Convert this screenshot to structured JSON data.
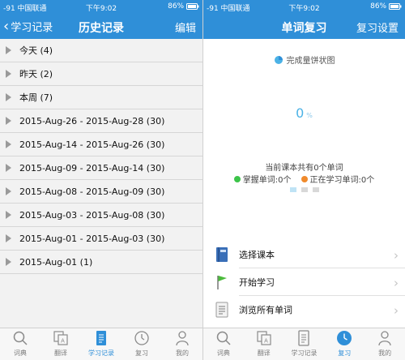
{
  "left_screen": {
    "status": {
      "carrier": "-91 中国联通",
      "time": "下午9:02",
      "battery": "86%"
    },
    "nav": {
      "back_label": "学习记录",
      "title": "历史记录",
      "edit_label": "编辑"
    },
    "history_rows": [
      {
        "label": "今天 (4)"
      },
      {
        "label": "昨天 (2)"
      },
      {
        "label": "本周 (7)"
      },
      {
        "label": "2015-Aug-26 - 2015-Aug-28 (30)"
      },
      {
        "label": "2015-Aug-14 - 2015-Aug-26 (30)"
      },
      {
        "label": "2015-Aug-09 - 2015-Aug-14 (30)"
      },
      {
        "label": "2015-Aug-08 - 2015-Aug-09 (30)"
      },
      {
        "label": "2015-Aug-03 - 2015-Aug-08 (30)"
      },
      {
        "label": "2015-Aug-01 - 2015-Aug-03 (30)"
      },
      {
        "label": "2015-Aug-01 (1)"
      }
    ],
    "tabs": [
      {
        "label": "词典",
        "icon": "search-icon",
        "active": false
      },
      {
        "label": "翻译",
        "icon": "translate-icon",
        "active": false
      },
      {
        "label": "学习记录",
        "icon": "notes-icon",
        "active": true
      },
      {
        "label": "复习",
        "icon": "clock-icon",
        "active": false
      },
      {
        "label": "我的",
        "icon": "person-icon",
        "active": false
      }
    ]
  },
  "right_screen": {
    "status": {
      "carrier": "-91 中国联通",
      "time": "下午9:02",
      "battery": "86%"
    },
    "nav": {
      "title": "单词复习",
      "settings_label": "复习设置"
    },
    "chart": {
      "title": "完成量饼状图",
      "percent_value": "0",
      "percent_unit": "%",
      "total_text": "当前课本共有0个单词",
      "mastered_text": "掌握单词:0个",
      "learning_text": "正在学习单词:0个"
    },
    "menu": [
      {
        "label": "选择课本",
        "icon": "book-icon"
      },
      {
        "label": "开始学习",
        "icon": "flag-icon"
      },
      {
        "label": "浏览所有单词",
        "icon": "list-icon"
      }
    ],
    "tabs": [
      {
        "label": "词典",
        "icon": "search-icon",
        "active": false
      },
      {
        "label": "翻译",
        "icon": "translate-icon",
        "active": false
      },
      {
        "label": "学习记录",
        "icon": "notes-icon",
        "active": false
      },
      {
        "label": "复习",
        "icon": "clock-icon",
        "active": true
      },
      {
        "label": "我的",
        "icon": "person-icon",
        "active": false
      }
    ]
  },
  "colors": {
    "accent": "#2f8fd8",
    "mastered": "#3cc44a",
    "learning": "#f08a2c",
    "percent": "#4bb2e6"
  }
}
